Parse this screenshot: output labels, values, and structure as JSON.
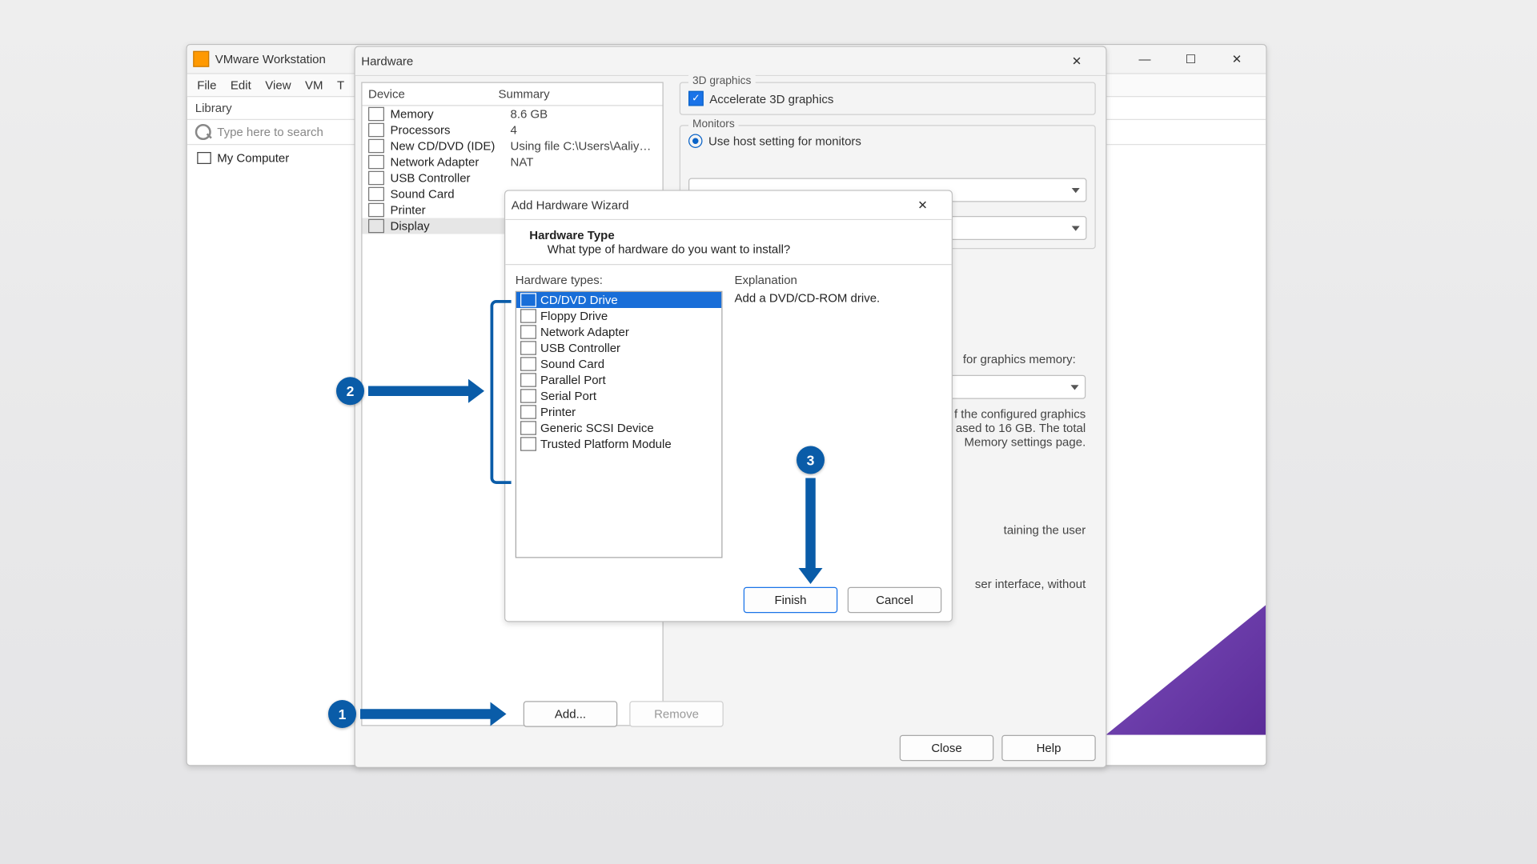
{
  "vmw": {
    "title": "VMware Workstation",
    "menu": [
      "File",
      "Edit",
      "View",
      "VM",
      "T"
    ],
    "library": "Library",
    "search_placeholder": "Type here to search",
    "tree_item": "My Computer"
  },
  "hw": {
    "title": "Hardware",
    "head_device": "Device",
    "head_summary": "Summary",
    "rows": [
      {
        "name": "Memory",
        "summary": "8.6 GB"
      },
      {
        "name": "Processors",
        "summary": "4"
      },
      {
        "name": "New CD/DVD (IDE)",
        "summary": "Using file C:\\Users\\Aaliyan\\D..."
      },
      {
        "name": "Network Adapter",
        "summary": "NAT"
      },
      {
        "name": "USB Controller",
        "summary": ""
      },
      {
        "name": "Sound Card",
        "summary": ""
      },
      {
        "name": "Printer",
        "summary": ""
      },
      {
        "name": "Display",
        "summary": ""
      }
    ],
    "add": "Add...",
    "remove": "Remove",
    "close": "Close",
    "help": "Help",
    "g3d": "3D graphics",
    "g3d_chk": "Accelerate 3D graphics",
    "mon": "Monitors",
    "mon_radio": "Use host setting for monitors",
    "gmem": "for graphics memory:",
    "note1": "f the configured graphics",
    "note2": "ased to 16 GB. The total",
    "note3": "Memory settings page.",
    "note4": "taining the user",
    "note5": "ser interface, without"
  },
  "wizard": {
    "title": "Add Hardware Wizard",
    "heading": "Hardware Type",
    "sub": "What type of hardware do you want to install?",
    "types_label": "Hardware types:",
    "types": [
      "CD/DVD Drive",
      "Floppy Drive",
      "Network Adapter",
      "USB Controller",
      "Sound Card",
      "Parallel Port",
      "Serial Port",
      "Printer",
      "Generic SCSI Device",
      "Trusted Platform Module"
    ],
    "expl_label": "Explanation",
    "expl_text": "Add a DVD/CD-ROM drive.",
    "finish": "Finish",
    "cancel": "Cancel"
  },
  "call": {
    "c1": "1",
    "c2": "2",
    "c3": "3"
  }
}
